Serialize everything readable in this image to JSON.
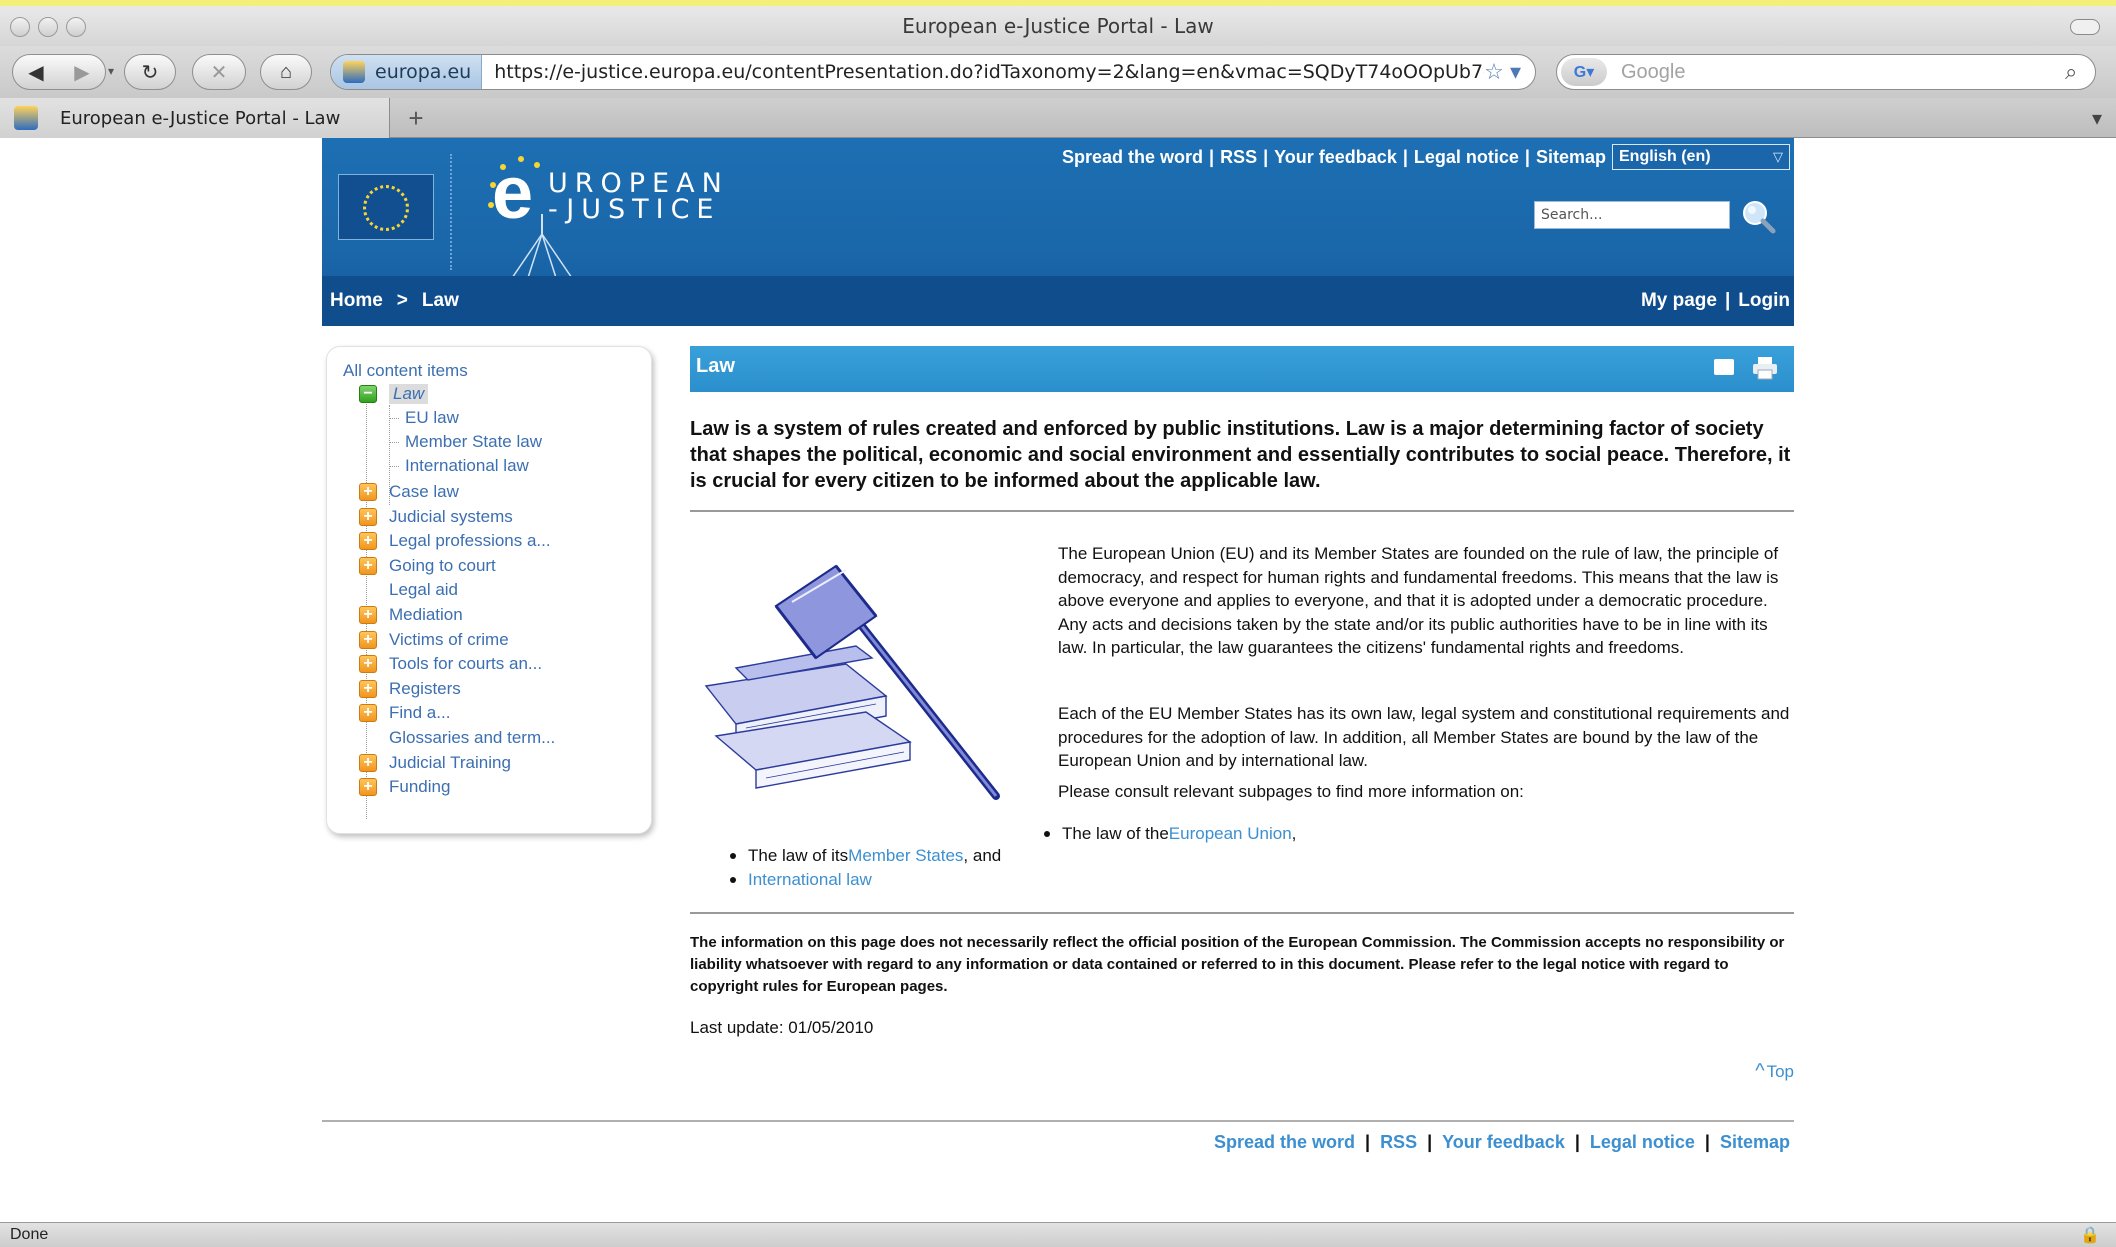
{
  "window": {
    "title": "European e-Justice Portal - Law"
  },
  "browser": {
    "url_site": "europa.eu",
    "url": "https://e-justice.europa.eu/contentPresentation.do?idTaxonomy=2&lang=en&vmac=SQDyT74oOOpUb7-qII",
    "search_placeholder": "Google",
    "tab_label": "European e-Justice Portal - Law",
    "status": "Done"
  },
  "header": {
    "logo_e": "e",
    "logo_line1": "UROPEAN",
    "logo_line2": "-JUSTICE",
    "toplinks": [
      "Spread the word",
      "RSS",
      "Your feedback",
      "Legal notice",
      "Sitemap"
    ],
    "language": "English (en)",
    "search_placeholder": "Search..."
  },
  "nav": {
    "breadcrumb": [
      "Home",
      "Law"
    ],
    "user_links": [
      "My page",
      "Login"
    ]
  },
  "sidebar": {
    "heading": "All content items",
    "active": "Law",
    "sub_items": [
      "EU law",
      "Member State law",
      "International law"
    ],
    "items": [
      {
        "label": "Case law",
        "icon": "plus"
      },
      {
        "label": "Judicial systems",
        "icon": "plus"
      },
      {
        "label": "Legal professions a...",
        "icon": "plus"
      },
      {
        "label": "Going to court",
        "icon": "plus"
      },
      {
        "label": "Legal aid",
        "icon": "none"
      },
      {
        "label": "Mediation",
        "icon": "plus"
      },
      {
        "label": "Victims of crime",
        "icon": "plus"
      },
      {
        "label": "Tools for courts an...",
        "icon": "plus"
      },
      {
        "label": "Registers",
        "icon": "plus"
      },
      {
        "label": "Find a...",
        "icon": "plus"
      },
      {
        "label": "Glossaries and term...",
        "icon": "none"
      },
      {
        "label": "Judicial Training",
        "icon": "plus"
      },
      {
        "label": "Funding",
        "icon": "plus"
      }
    ]
  },
  "main": {
    "title": "Law",
    "intro": "Law is a system of rules created and enforced by public institutions. Law is a major determining factor of society that shapes the political, economic and social environment and essentially contributes to social peace. Therefore, it is crucial for every citizen to be informed about the applicable law.",
    "para1": "The European Union (EU) and its Member States are founded on the rule of law, the principle of democracy, and respect for human rights and fundamental freedoms. This means that the law is above everyone and applies to everyone, and that it is adopted under a democratic procedure. Any acts and decisions taken by the state and/or its public authorities have to be in line with its law. In particular, the law guarantees the citizens' fundamental rights and freedoms.",
    "para2": "Each of the EU Member States has its own law, legal system and constitutional requirements and procedures for the adoption of law. In addition, all Member States are bound by the law of the European Union and by international law.",
    "para3": "Please consult relevant subpages to find more information on:",
    "bullet1_pre": "The law of the ",
    "bullet1_link": "European Union",
    "bullet1_post": ",",
    "bullet2_pre": "The law of its ",
    "bullet2_link": "Member States",
    "bullet2_post": ", and",
    "bullet3_link": "International law",
    "disclaimer": "The information on this page does not necessarily reflect the official position of the European Commission. The Commission accepts no responsibility or liability whatsoever with regard to any information or data contained or referred to in this document. Please refer to the legal notice with regard to copyright rules for European pages.",
    "last_update": "Last update: 01/05/2010",
    "top_link": "Top"
  },
  "footer": {
    "links": [
      "Spread the word",
      "RSS",
      "Your feedback",
      "Legal notice",
      "Sitemap"
    ]
  },
  "colors": {
    "banner": "#1d6fb3",
    "nav": "#0f4d8c",
    "link": "#3c8fd0",
    "section_head": "#3aa0da"
  }
}
